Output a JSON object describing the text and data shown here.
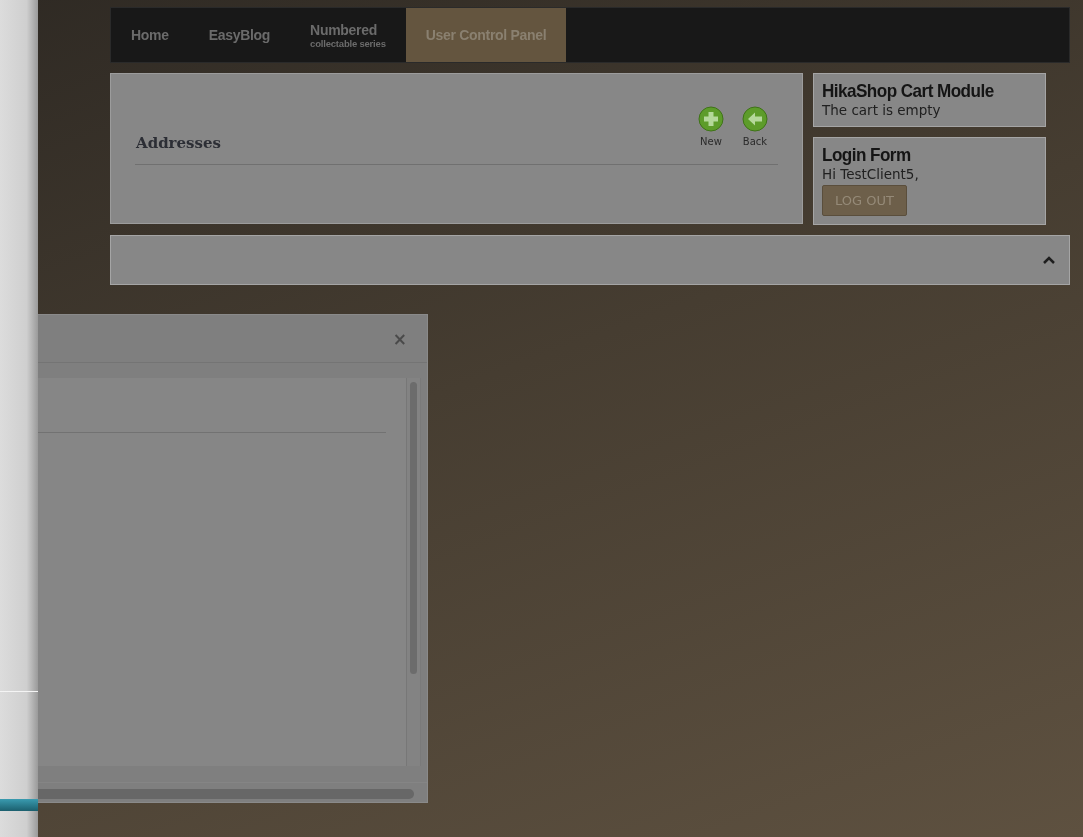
{
  "nav": {
    "items": [
      {
        "label": "Home",
        "selected": false
      },
      {
        "label": "EasyBlog",
        "selected": false
      },
      {
        "label": "Numbered",
        "sublabel": "collectable series",
        "selected": false
      },
      {
        "label": "User Control Panel",
        "selected": true
      }
    ]
  },
  "content": {
    "title": "Addresses",
    "toolbar": [
      {
        "label": "New",
        "kind": "new"
      },
      {
        "label": "Back",
        "kind": "back"
      }
    ]
  },
  "modules": [
    {
      "title": "HikaShop Cart Module",
      "text": "The cart is empty"
    },
    {
      "title": "Login Form",
      "text": "Hi TestClient5,",
      "button": "LOG OUT"
    }
  ],
  "modal": {
    "close": "×"
  }
}
